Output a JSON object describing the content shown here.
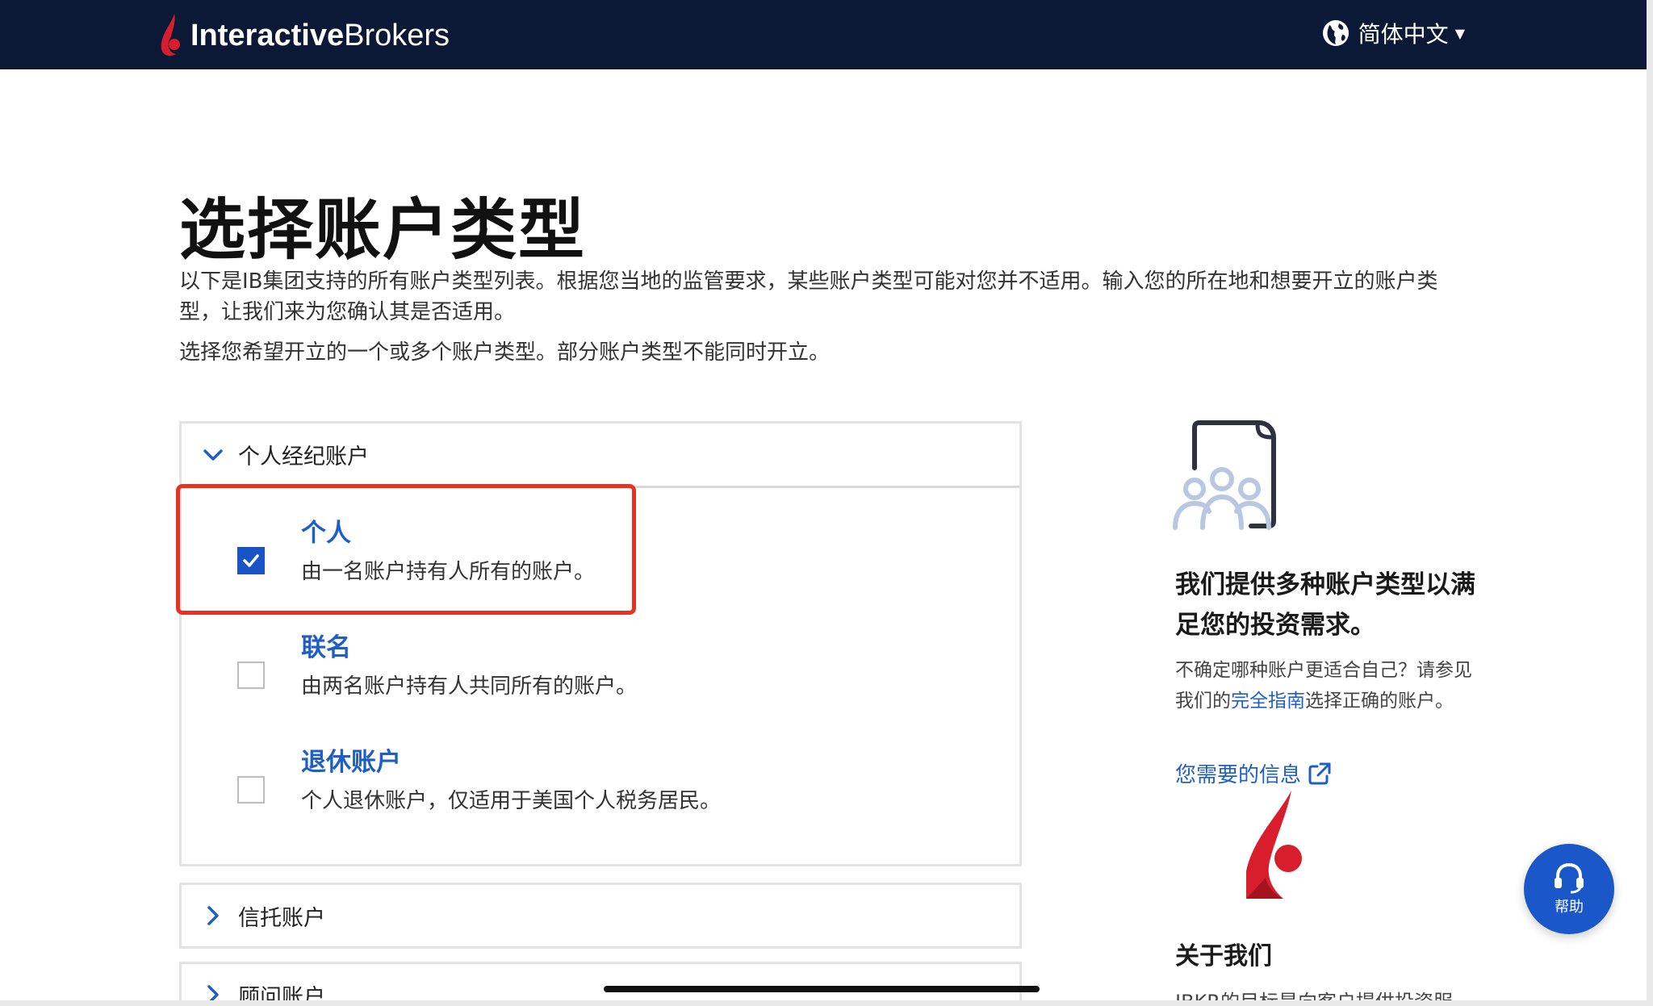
{
  "header": {
    "logo_bold": "Interactive",
    "logo_light": "Brokers",
    "language": "简体中文"
  },
  "main": {
    "title": "选择账户类型",
    "intro": "以下是IB集团支持的所有账户类型列表。根据您当地的监管要求，某些账户类型可能对您并不适用。输入您的所在地和想要开立的账户类型，让我们来为您确认其是否适用。",
    "intro2": "选择您希望开立的一个或多个账户类型。部分账户类型不能同时开立。"
  },
  "accordion": {
    "individual_brokerage": {
      "label": "个人经纪账户",
      "expanded": true,
      "options": [
        {
          "title": "个人",
          "desc": "由一名账户持有人所有的账户。",
          "checked": true
        },
        {
          "title": "联名",
          "desc": "由两名账户持有人共同所有的账户。",
          "checked": false
        },
        {
          "title": "退休账户",
          "desc": "个人退休账户，仅适用于美国个人税务居民。",
          "checked": false
        }
      ]
    },
    "trust": {
      "label": "信托账户",
      "expanded": false
    },
    "advisor": {
      "label": "顾问账户",
      "expanded": false
    }
  },
  "sidebar": {
    "heading": "我们提供多种账户类型以满足您的投资需求。",
    "text_before": "不确定哪种账户更适合自己？请参见我们的",
    "text_link": "完全指南",
    "text_after": "选择正确的账户。",
    "info_link": "您需要的信息",
    "about_title": "关于我们",
    "about_text": "IBKR的目标是向客户提供投资服"
  },
  "help": {
    "label": "帮助"
  },
  "colors": {
    "navbar": "#0b1936",
    "accent_blue": "#1f5fc5",
    "checkbox_blue": "#1a54c4",
    "highlight_red": "#e53223",
    "ib_red": "#d81e2c"
  }
}
